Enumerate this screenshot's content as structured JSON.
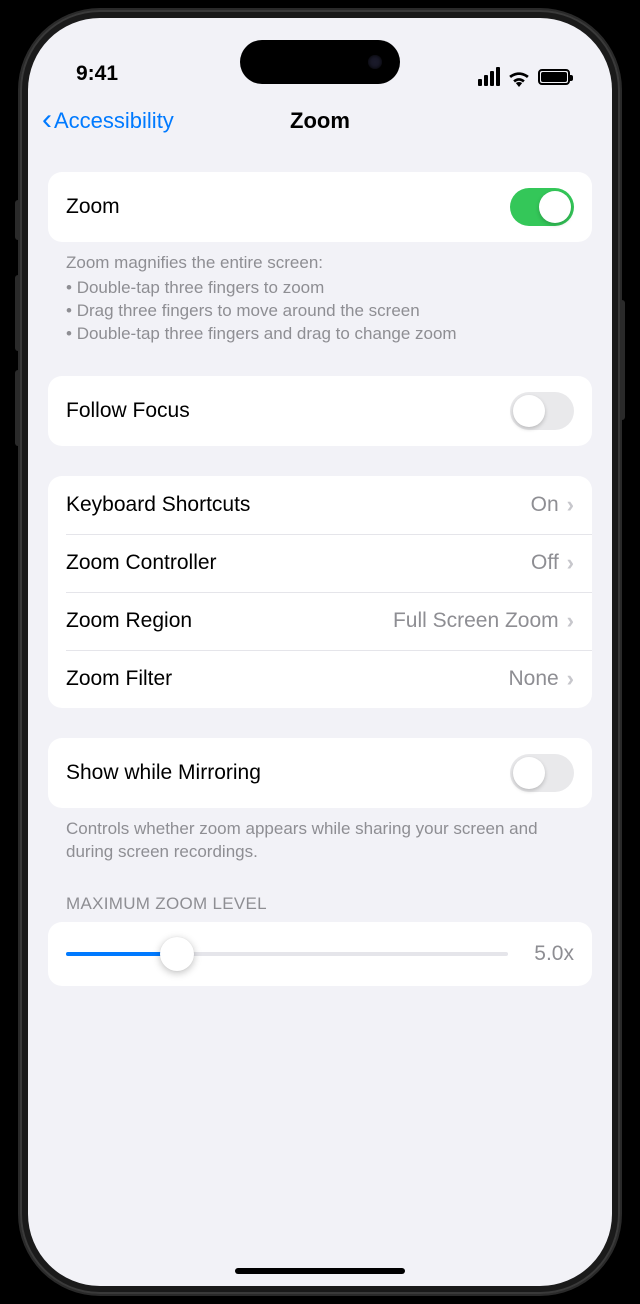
{
  "status": {
    "time": "9:41"
  },
  "nav": {
    "back": "Accessibility",
    "title": "Zoom"
  },
  "zoom_toggle": {
    "label": "Zoom",
    "on": true
  },
  "zoom_help": {
    "heading": "Zoom magnifies the entire screen:",
    "lines": [
      "Double-tap three fingers to zoom",
      "Drag three fingers to move around the screen",
      "Double-tap three fingers and drag to change zoom"
    ]
  },
  "follow_focus": {
    "label": "Follow Focus",
    "on": false
  },
  "options": {
    "keyboard_shortcuts": {
      "label": "Keyboard Shortcuts",
      "value": "On"
    },
    "zoom_controller": {
      "label": "Zoom Controller",
      "value": "Off"
    },
    "zoom_region": {
      "label": "Zoom Region",
      "value": "Full Screen Zoom"
    },
    "zoom_filter": {
      "label": "Zoom Filter",
      "value": "None"
    }
  },
  "mirroring": {
    "label": "Show while Mirroring",
    "on": false,
    "help": "Controls whether zoom appears while sharing your screen and during screen recordings."
  },
  "max_zoom": {
    "header": "MAXIMUM ZOOM LEVEL",
    "value_label": "5.0x",
    "percent": 25
  }
}
